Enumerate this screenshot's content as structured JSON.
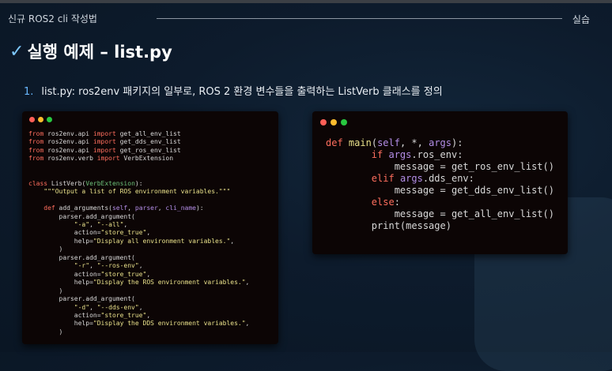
{
  "header": {
    "title": "신규 ROS2 cli 작성법",
    "section": "실습"
  },
  "slide": {
    "title": "실행 예제 – list.py",
    "step_number": "1.",
    "step_text": "list.py: ros2env 패키지의 일부로, ROS 2 환경 변수들을 출력하는 ListVerb 클래스를 정의"
  },
  "code_left": [
    [
      [
        "kw",
        "from"
      ],
      [
        "t",
        " ros2env.api "
      ],
      [
        "kw",
        "import"
      ],
      [
        "t",
        " get_all_env_list"
      ]
    ],
    [
      [
        "kw",
        "from"
      ],
      [
        "t",
        " ros2env.api "
      ],
      [
        "kw",
        "import"
      ],
      [
        "t",
        " get_dds_env_list"
      ]
    ],
    [
      [
        "kw",
        "from"
      ],
      [
        "t",
        " ros2env.api "
      ],
      [
        "kw",
        "import"
      ],
      [
        "t",
        " get_ros_env_list"
      ]
    ],
    [
      [
        "kw",
        "from"
      ],
      [
        "t",
        " ros2env.verb "
      ],
      [
        "kw",
        "import"
      ],
      [
        "t",
        " VerbExtension"
      ]
    ],
    [],
    [],
    [
      [
        "kw",
        "class"
      ],
      [
        "t",
        " ListVerb("
      ],
      [
        "cl",
        "VerbExtension"
      ],
      [
        "t",
        "):"
      ]
    ],
    [
      [
        "t",
        "    "
      ],
      [
        "st",
        "\"\"\"Output a list of ROS environment variables.\"\"\""
      ]
    ],
    [],
    [
      [
        "t",
        "    "
      ],
      [
        "kw",
        "def"
      ],
      [
        "t",
        " add_arguments("
      ],
      [
        "ar",
        "self"
      ],
      [
        "t",
        ", "
      ],
      [
        "ar",
        "parser"
      ],
      [
        "t",
        ", "
      ],
      [
        "ar",
        "cli_name"
      ],
      [
        "t",
        "):"
      ]
    ],
    [
      [
        "t",
        "        parser.add_argument("
      ]
    ],
    [
      [
        "t",
        "            "
      ],
      [
        "st",
        "\"-a\""
      ],
      [
        "t",
        ", "
      ],
      [
        "st",
        "\"--all\""
      ],
      [
        "t",
        ","
      ]
    ],
    [
      [
        "t",
        "            action="
      ],
      [
        "st",
        "\"store_true\""
      ],
      [
        "t",
        ","
      ]
    ],
    [
      [
        "t",
        "            help="
      ],
      [
        "st",
        "\"Display all environment variables.\""
      ],
      [
        "t",
        ","
      ]
    ],
    [
      [
        "t",
        "        )"
      ]
    ],
    [
      [
        "t",
        "        parser.add_argument("
      ]
    ],
    [
      [
        "t",
        "            "
      ],
      [
        "st",
        "\"-r\""
      ],
      [
        "t",
        ", "
      ],
      [
        "st",
        "\"--ros-env\""
      ],
      [
        "t",
        ","
      ]
    ],
    [
      [
        "t",
        "            action="
      ],
      [
        "st",
        "\"store_true\""
      ],
      [
        "t",
        ","
      ]
    ],
    [
      [
        "t",
        "            help="
      ],
      [
        "st",
        "\"Display the ROS environment variables.\""
      ],
      [
        "t",
        ","
      ]
    ],
    [
      [
        "t",
        "        )"
      ]
    ],
    [
      [
        "t",
        "        parser.add_argument("
      ]
    ],
    [
      [
        "t",
        "            "
      ],
      [
        "st",
        "\"-d\""
      ],
      [
        "t",
        ", "
      ],
      [
        "st",
        "\"--dds-env\""
      ],
      [
        "t",
        ","
      ]
    ],
    [
      [
        "t",
        "            action="
      ],
      [
        "st",
        "\"store_true\""
      ],
      [
        "t",
        ","
      ]
    ],
    [
      [
        "t",
        "            help="
      ],
      [
        "st",
        "\"Display the DDS environment variables.\""
      ],
      [
        "t",
        ","
      ]
    ],
    [
      [
        "t",
        "        )"
      ]
    ]
  ],
  "code_right": [
    [
      [
        "kw",
        "def"
      ],
      [
        "t",
        " "
      ],
      [
        "fn",
        "main"
      ],
      [
        "t",
        "("
      ],
      [
        "ar",
        "self"
      ],
      [
        "t",
        ", *, "
      ],
      [
        "ar",
        "args"
      ],
      [
        "t",
        "):"
      ]
    ],
    [
      [
        "t",
        "        "
      ],
      [
        "kw",
        "if"
      ],
      [
        "t",
        " "
      ],
      [
        "ar",
        "args"
      ],
      [
        "t",
        ".ros_env:"
      ]
    ],
    [
      [
        "t",
        "            message = get_ros_env_list()"
      ]
    ],
    [
      [
        "t",
        "        "
      ],
      [
        "kw",
        "elif"
      ],
      [
        "t",
        " "
      ],
      [
        "ar",
        "args"
      ],
      [
        "t",
        ".dds_env:"
      ]
    ],
    [
      [
        "t",
        "            message = get_dds_env_list()"
      ]
    ],
    [
      [
        "t",
        "        "
      ],
      [
        "kw",
        "else"
      ],
      [
        "t",
        ":"
      ]
    ],
    [
      [
        "t",
        "            message = get_all_env_list()"
      ]
    ],
    [
      [
        "t",
        "        print(message)"
      ]
    ]
  ],
  "colors": {
    "keyword": "#ff6e5e",
    "string": "#e8e08a",
    "argument": "#b48ee8",
    "classname": "#6cc27a",
    "accent": "#69b7ff"
  }
}
